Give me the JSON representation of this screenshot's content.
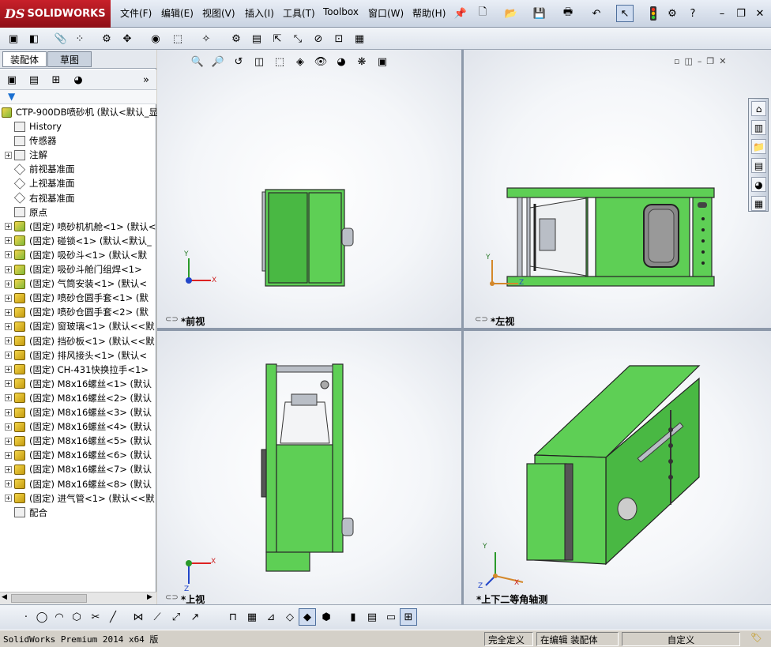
{
  "app": {
    "name": "SOLIDWORKS",
    "logo_prefix": "DS",
    "menu": [
      "文件(F)",
      "编辑(E)",
      "视图(V)",
      "插入(I)",
      "工具(T)",
      "Toolbox",
      "窗口(W)",
      "帮助(H)"
    ]
  },
  "panel": {
    "tabs": [
      "装配体",
      "草图"
    ],
    "active_tab": "装配体",
    "root": "CTP-900DB喷砂机  (默认<默认_显",
    "tree": [
      {
        "label": "History",
        "icon": "history-icon",
        "expandable": false
      },
      {
        "label": "传感器",
        "icon": "sensor-icon",
        "expandable": false
      },
      {
        "label": "注解",
        "icon": "annotation-icon",
        "expandable": true
      },
      {
        "label": "前视基准面",
        "icon": "plane-icon",
        "expandable": false
      },
      {
        "label": "上视基准面",
        "icon": "plane-icon",
        "expandable": false
      },
      {
        "label": "右视基准面",
        "icon": "plane-icon",
        "expandable": false
      },
      {
        "label": "原点",
        "icon": "origin-icon",
        "expandable": false
      },
      {
        "label": "(固定) 喷砂机机舱<1> (默认<",
        "icon": "assembly-icon",
        "expandable": true
      },
      {
        "label": "(固定) 碰锁<1> (默认<默认_",
        "icon": "assembly-icon",
        "expandable": true
      },
      {
        "label": "(固定) 吸砂斗<1> (默认<默",
        "icon": "assembly-icon",
        "expandable": true
      },
      {
        "label": "(固定) 吸砂斗舱门组焊<1>",
        "icon": "assembly-icon",
        "expandable": true
      },
      {
        "label": "(固定) 气筒安装<1> (默认<",
        "icon": "assembly-icon",
        "expandable": true
      },
      {
        "label": "(固定) 喷砂仓圆手套<1> (默",
        "icon": "part-icon",
        "expandable": true
      },
      {
        "label": "(固定) 喷砂仓圆手套<2> (默",
        "icon": "part-icon",
        "expandable": true
      },
      {
        "label": "(固定) 窗玻璃<1> (默认<<默",
        "icon": "part-icon",
        "expandable": true
      },
      {
        "label": "(固定) 挡砂板<1> (默认<<默",
        "icon": "part-icon",
        "expandable": true
      },
      {
        "label": "(固定) 排风接头<1> (默认<",
        "icon": "part-icon",
        "expandable": true
      },
      {
        "label": "(固定) CH-431快换拉手<1>",
        "icon": "part-icon",
        "expandable": true
      },
      {
        "label": "(固定) M8x16螺丝<1> (默认",
        "icon": "part-icon",
        "expandable": true
      },
      {
        "label": "(固定) M8x16螺丝<2> (默认",
        "icon": "part-icon",
        "expandable": true
      },
      {
        "label": "(固定) M8x16螺丝<3> (默认",
        "icon": "part-icon",
        "expandable": true
      },
      {
        "label": "(固定) M8x16螺丝<4> (默认",
        "icon": "part-icon",
        "expandable": true
      },
      {
        "label": "(固定) M8x16螺丝<5> (默认",
        "icon": "part-icon",
        "expandable": true
      },
      {
        "label": "(固定) M8x16螺丝<6> (默认",
        "icon": "part-icon",
        "expandable": true
      },
      {
        "label": "(固定) M8x16螺丝<7> (默认",
        "icon": "part-icon",
        "expandable": true
      },
      {
        "label": "(固定) M8x16螺丝<8> (默认",
        "icon": "part-icon",
        "expandable": true
      },
      {
        "label": "(固定) 进气管<1> (默认<<默",
        "icon": "part-icon",
        "expandable": true
      },
      {
        "label": "配合",
        "icon": "mate-icon",
        "expandable": false
      }
    ]
  },
  "viewports": {
    "front": "*前视",
    "left": "*左视",
    "top": "*上视",
    "iso": "*上下二等角轴测"
  },
  "axes": {
    "x": "X",
    "y": "Y",
    "z": "Z"
  },
  "status": {
    "product": "SolidWorks Premium 2014 x64 版",
    "constraint": "完全定义",
    "mode": "在编辑 装配体",
    "units": "自定义"
  },
  "colors": {
    "model_green": "#5ecf55",
    "brand_red": "#c8202a"
  }
}
